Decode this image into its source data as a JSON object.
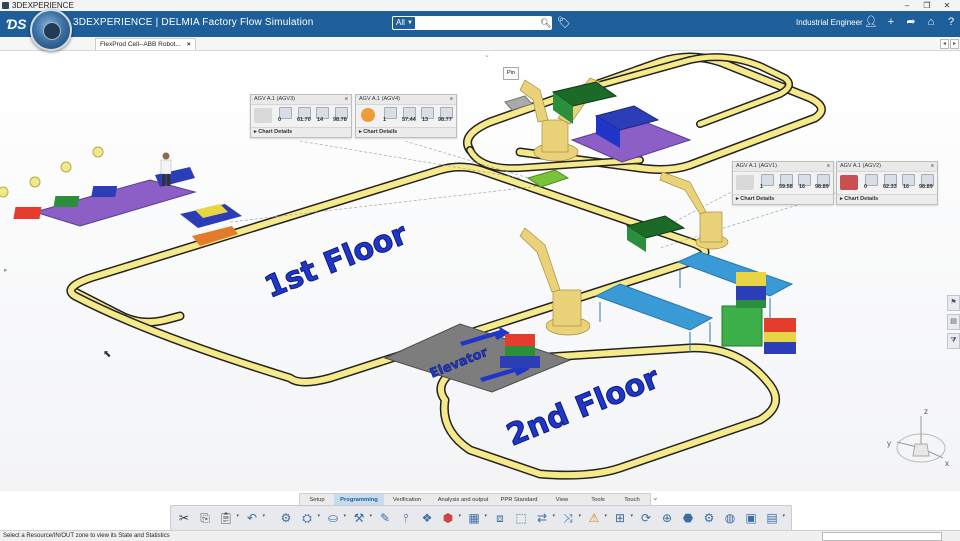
{
  "window": {
    "title": "3DEXPERIENCE"
  },
  "header": {
    "app_title": "3DEXPERIENCE | DELMIA Factory Flow Simulation",
    "search_scope": "All",
    "search_placeholder": "",
    "user_role": "Industrial Engineer"
  },
  "document_tab": {
    "label": "FlexProd Cell--ABB Robot..."
  },
  "pin_label": "Pin",
  "scene_labels": {
    "floor1": "1st Floor",
    "floor2": "2nd Floor",
    "elevator": "Elevator"
  },
  "agv_panels": [
    {
      "title": "AGV A.1 (AGV3)",
      "v1": "0",
      "v2": "61.70",
      "v3": "14",
      "v4": "98.78",
      "footer": "Chart Details"
    },
    {
      "title": "AGV A.1 (AGV4)",
      "v1": "1",
      "v2": "57.44",
      "v3": "13",
      "v4": "98.77",
      "footer": "Chart Details"
    },
    {
      "title": "AGV A.1 (AGV1)",
      "v1": "1",
      "v2": "59.58",
      "v3": "16",
      "v4": "98.89",
      "footer": "Chart Details"
    },
    {
      "title": "AGV A.1 (AGV2)",
      "v1": "0",
      "v2": "62.33",
      "v3": "16",
      "v4": "98.89",
      "footer": "Chart Details"
    }
  ],
  "compass_axes": {
    "x": "x",
    "y": "y",
    "z": "z"
  },
  "section_tabs": [
    "Setup",
    "Programming",
    "Verification",
    "Analysis and output",
    "PPR Standard",
    "View",
    "Tools",
    "Touch"
  ],
  "active_section": "Programming",
  "status": {
    "text": "Select a Resource/IN/OUT zone to view its State and Statistics"
  },
  "colors": {
    "header_blue": "#1e5f9a",
    "track_yellow": "#f5e98a",
    "floor_text_blue": "#1f36c9",
    "robot_yellow": "#e9d27a",
    "conveyor_cyan": "#3a9ad6",
    "fixture_purple": "#8b5fc6"
  }
}
